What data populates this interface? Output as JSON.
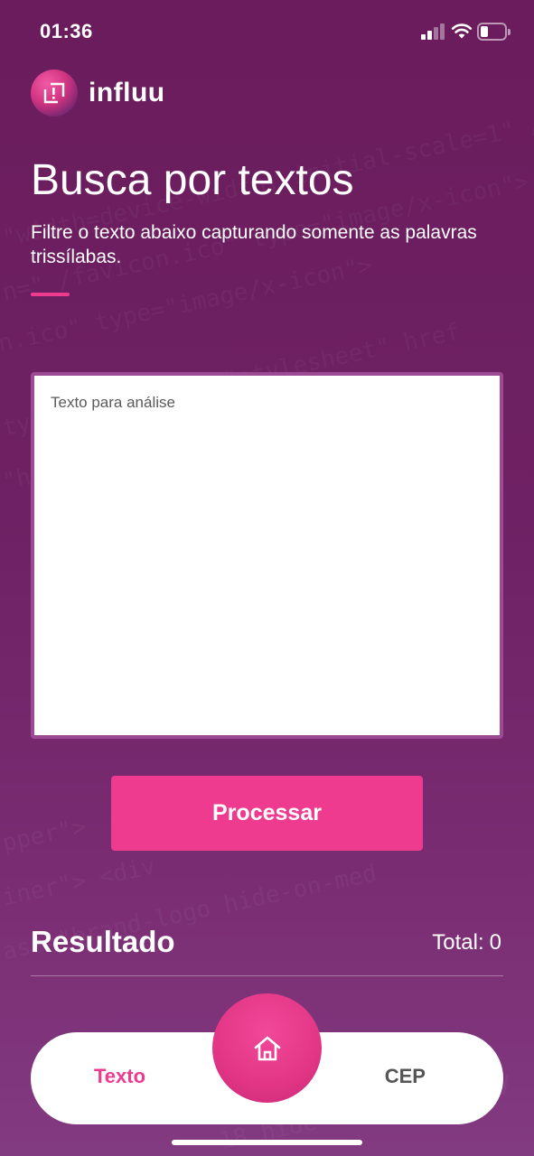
{
  "status_bar": {
    "time": "01:36",
    "signal_icon": "cellular-signal-icon",
    "wifi_icon": "wifi-icon",
    "battery_icon": "battery-icon",
    "battery_level": 0.3
  },
  "brand": {
    "logo_text": "influu",
    "logo_icon": "influu-logo-icon"
  },
  "page": {
    "title": "Busca por textos",
    "subtitle": "Filtre o texto abaixo capturando somente as palavras trissílabas."
  },
  "form": {
    "textarea_placeholder": "Texto para análise",
    "textarea_value": "",
    "process_label": "Processar"
  },
  "result": {
    "title": "Resultado",
    "total_label": "Total:",
    "total_value": "0"
  },
  "tabbar": {
    "left_label": "Texto",
    "right_label": "CEP",
    "center_icon": "home-icon"
  },
  "colors": {
    "background": "#6a1c5c",
    "accent": "#ee3a8f",
    "tab_inactive": "#555555"
  }
}
